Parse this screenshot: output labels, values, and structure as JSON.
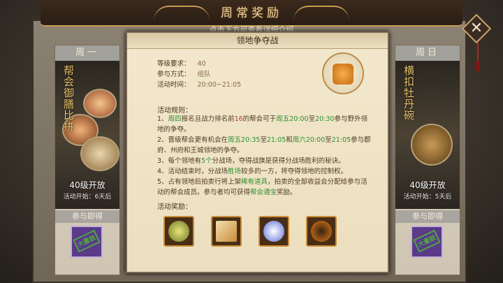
{
  "banner": {
    "title": "周常奖励",
    "subtitle": "点击下方可查看详细介绍"
  },
  "columns": [
    {
      "day": "周一",
      "event_name": "帮会御膳比拼",
      "level_text": "40级开放",
      "start_text": "活动开始：6天后",
      "sub_label": "参与即得",
      "stamp": "大量鼓"
    },
    {
      "day": "周日",
      "event_name": "横扣牡丹碗",
      "level_text": "40级开放",
      "start_text": "活动开始：5天后",
      "sub_label": "参与即得",
      "stamp": "大量鼓"
    }
  ],
  "popup": {
    "title": "领地争夺战",
    "info": [
      {
        "label": "等级要求：",
        "value": "40"
      },
      {
        "label": "参与方式：",
        "value": "组队"
      },
      {
        "label": "活动时间：",
        "value": "20:00~21:05"
      }
    ],
    "rules_header": "活动规则：",
    "rules": {
      "r1_a": "1、",
      "r1_b": "周四",
      "r1_c": "报名且战力排名前",
      "r1_d": "16",
      "r1_e": "的帮会可于",
      "r1_f": "周五20:00",
      "r1_g": "至",
      "r1_h": "20:30",
      "r1_i": "参与野外领地的争夺。",
      "r2_a": "2、晋级帮会更有机会在",
      "r2_b": "周五20:35",
      "r2_c": "至",
      "r2_d": "21:05",
      "r2_e": "和",
      "r2_f": "周六20:00",
      "r2_g": "至",
      "r2_h": "21:05",
      "r2_i": "参与郡府、州府和王城领地的争夺。",
      "r3_a": "3、每个领地有",
      "r3_b": "5个",
      "r3_c": "分战场，夺得战旗是获得分战场胜利的秘诀。",
      "r4_a": "4、活动结束时，分战场",
      "r4_b": "胜场",
      "r4_c": "较多的一方，将夺得领地的控制权。",
      "r5_a": "5、占有领地后拍卖行将上架",
      "r5_b": "稀有道具",
      "r5_c": "，拍卖的全部收益会分配给参与活动的帮会成员。参与者均可获得",
      "r5_d": "帮会通宝",
      "r5_e": "奖励。"
    },
    "rewards_header": "活动奖励：",
    "rewards": [
      "jade-pendant-icon",
      "scroll-icon",
      "crystal-orb-icon",
      "fire-spirit-icon"
    ]
  },
  "colors": {
    "highlight_green": "#2f8f2f",
    "highlight_red": "#c0392b",
    "gold": "#c89b52"
  }
}
